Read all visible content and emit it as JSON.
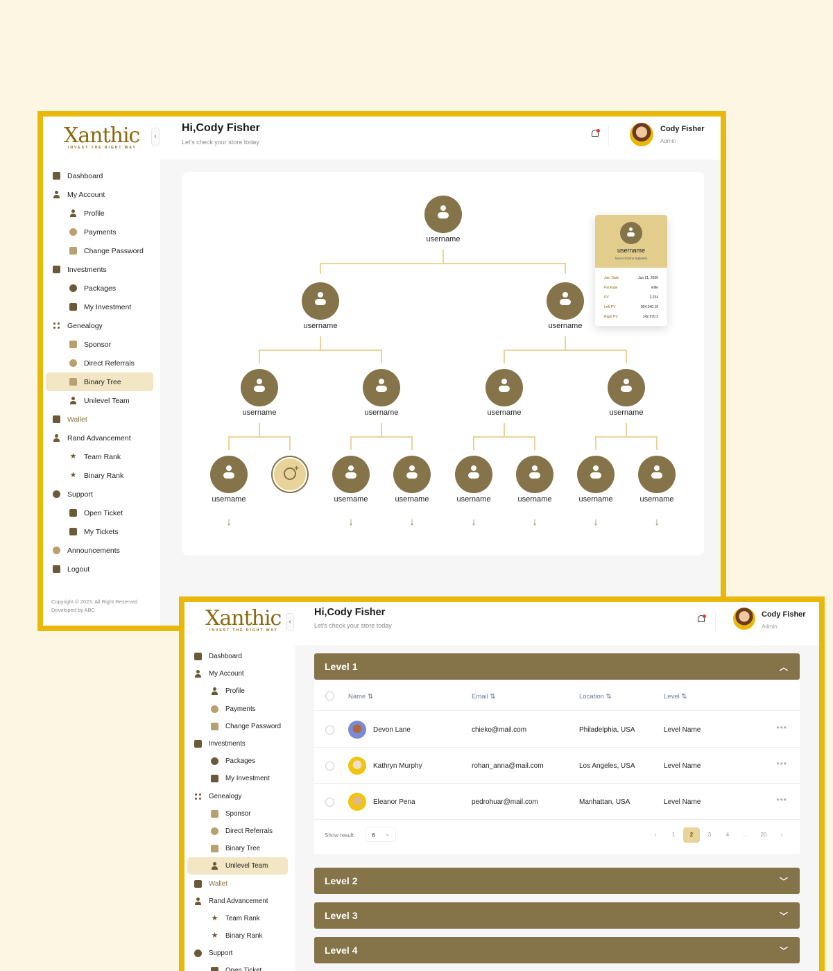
{
  "brand": {
    "logo_title": "Xanthic",
    "logo_tagline": "INVEST THE RIGHT WAY",
    "colors": {
      "accent": "#857349",
      "frame": "#e8b90a",
      "highlight": "#f2e6c4"
    }
  },
  "header": {
    "greeting": "Hi,Cody Fisher",
    "subtitle": "Let's check your store today",
    "user_name": "Cody Fisher",
    "user_role": "Admin",
    "notification_icon": "bell-icon"
  },
  "sidebar_primary": {
    "items": [
      {
        "label": "Dashboard"
      },
      {
        "label": "My Account"
      },
      {
        "label": "Profile"
      },
      {
        "label": "Payments"
      },
      {
        "label": "Change Password"
      },
      {
        "label": "Investments"
      },
      {
        "label": "Packages"
      },
      {
        "label": "My Investment"
      },
      {
        "label": "Genealogy"
      },
      {
        "label": "Sponsor"
      },
      {
        "label": "Direct Referrals"
      },
      {
        "label": "Binary Tree"
      },
      {
        "label": "Unilevel Team"
      },
      {
        "label": "Wallet"
      },
      {
        "label": "Rand Advancement"
      },
      {
        "label": "Team Rank"
      },
      {
        "label": "Binary Rank"
      },
      {
        "label": "Support"
      },
      {
        "label": "Open Ticket"
      },
      {
        "label": "My Tickets"
      },
      {
        "label": "Announcements"
      },
      {
        "label": "Logout"
      }
    ]
  },
  "copyright": {
    "line1": "Copyright © 2023. All Right Reserved",
    "line2": "Developed by ABC"
  },
  "tree": {
    "node_label": "username",
    "popup": {
      "name": "username",
      "full_name": "favour Ezinne Egbulefu",
      "rows": [
        {
          "key": "Join Date",
          "value": "Jun 21, 2020"
        },
        {
          "key": "Package",
          "value": "Elite"
        },
        {
          "key": "PV",
          "value": "2,234"
        },
        {
          "key": "Left PV",
          "value": "924,340.19"
        },
        {
          "key": "Right PV",
          "value": "142,970.3"
        }
      ]
    }
  },
  "unilevel": {
    "levels": [
      {
        "label": "Level 1"
      },
      {
        "label": "Level 2"
      },
      {
        "label": "Level 3"
      },
      {
        "label": "Level 4"
      }
    ],
    "columns": [
      "Name",
      "Email",
      "Location",
      "Level"
    ],
    "rows": [
      {
        "name": "Devon Lane",
        "email": "chieko@mail.com",
        "location": "Philadelphia, USA",
        "level": "Level Name"
      },
      {
        "name": "Kathryn Murphy",
        "email": "rohan_anna@mail.com",
        "location": "Los Angeles, USA",
        "level": "Level Name"
      },
      {
        "name": "Eleanor Pena",
        "email": "pedrohuar@mail.com",
        "location": "Manhattan, USA",
        "level": "Level Name"
      }
    ],
    "show_result_label": "Show result:",
    "show_result_value": "6",
    "pages": [
      "1",
      "2",
      "3",
      "4",
      "...",
      "20"
    ],
    "current_page": "2"
  }
}
